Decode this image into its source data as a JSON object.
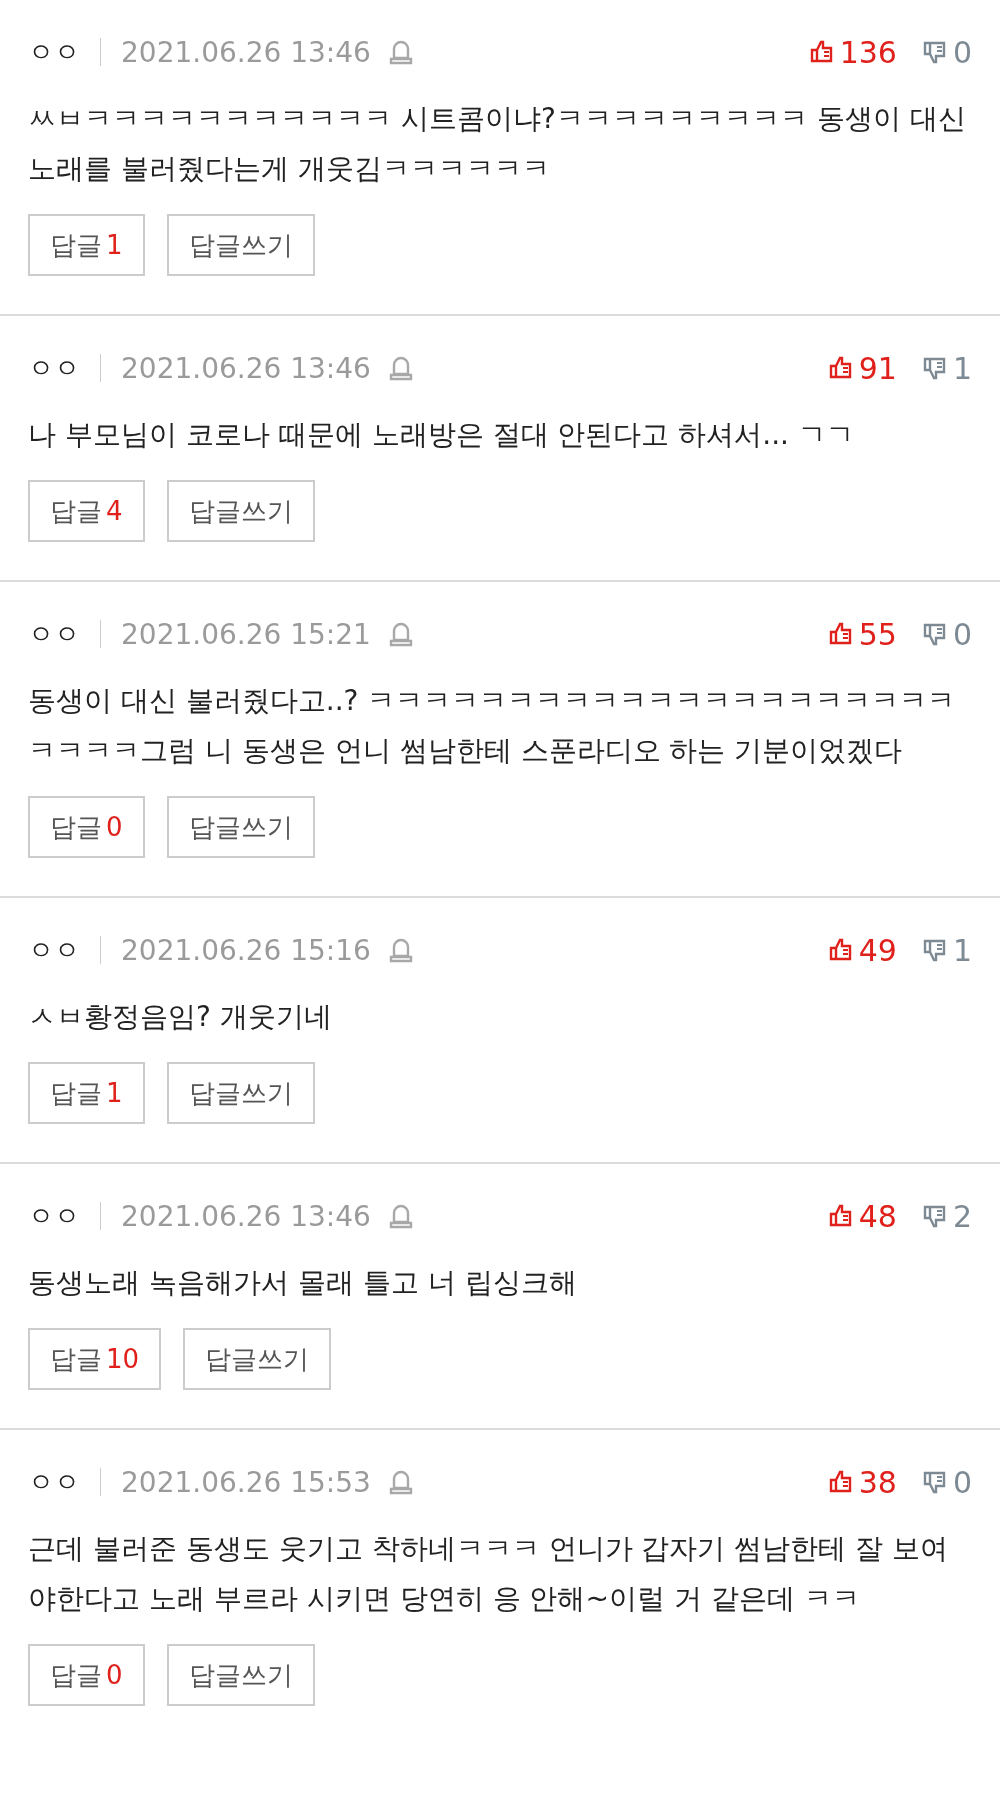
{
  "comments": [
    {
      "author": "ㅇㅇ",
      "date": "2021.06.26 13:46",
      "likes": "136",
      "dislikes": "0",
      "text": "ㅆㅂㅋㅋㅋㅋㅋㅋㅋㅋㅋㅋㅋ 시트콤이냐?ㅋㅋㅋㅋㅋㅋㅋㅋㅋ 동생이 대신 노래를 불러줬다는게 개웃김ㅋㅋㅋㅋㅋㅋ",
      "reply_label": "답글",
      "reply_count": "1",
      "write_label": "답글쓰기"
    },
    {
      "author": "ㅇㅇ",
      "date": "2021.06.26 13:46",
      "likes": "91",
      "dislikes": "1",
      "text": "나 부모님이 코로나 때문에 노래방은 절대 안된다고 하셔서... ㄱㄱ",
      "reply_label": "답글",
      "reply_count": "4",
      "write_label": "답글쓰기"
    },
    {
      "author": "ㅇㅇ",
      "date": "2021.06.26 15:21",
      "likes": "55",
      "dislikes": "0",
      "text": "동생이 대신 불러줬다고..? ㅋㅋㅋㅋㅋㅋㅋㅋㅋㅋㅋㅋㅋㅋㅋㅋㅋㅋㅋㅋㅋㅋㅋㅋㅋ그럼 니 동생은 언니 썸남한테 스푼라디오 하는 기분이었겠다",
      "reply_label": "답글",
      "reply_count": "0",
      "write_label": "답글쓰기"
    },
    {
      "author": "ㅇㅇ",
      "date": "2021.06.26 15:16",
      "likes": "49",
      "dislikes": "1",
      "text": "ㅅㅂ황정음임? 개웃기네",
      "reply_label": "답글",
      "reply_count": "1",
      "write_label": "답글쓰기"
    },
    {
      "author": "ㅇㅇ",
      "date": "2021.06.26 13:46",
      "likes": "48",
      "dislikes": "2",
      "text": "동생노래 녹음해가서 몰래 틀고 너 립싱크해",
      "reply_label": "답글",
      "reply_count": "10",
      "write_label": "답글쓰기"
    },
    {
      "author": "ㅇㅇ",
      "date": "2021.06.26 15:53",
      "likes": "38",
      "dislikes": "0",
      "text": "근데 불러준 동생도 웃기고 착하네ㅋㅋㅋ 언니가 갑자기 썸남한테 잘 보여야한다고 노래 부르라 시키면 당연히 응 안해~이럴 거 같은데 ㅋㅋ",
      "reply_label": "답글",
      "reply_count": "0",
      "write_label": "답글쓰기"
    }
  ]
}
